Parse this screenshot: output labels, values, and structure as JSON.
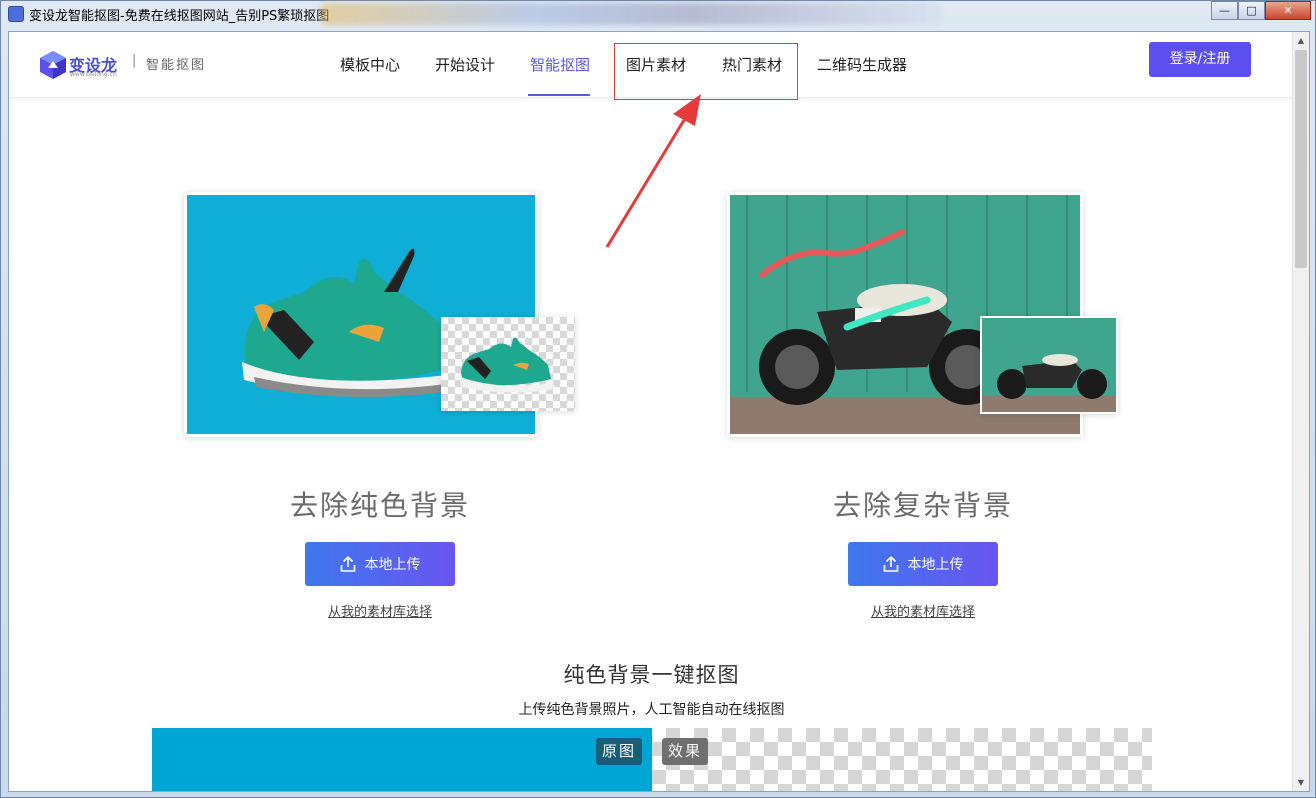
{
  "window": {
    "title": "变设龙智能抠图-免费在线抠图网站_告别PS繁琐抠图",
    "controls": {
      "minimize": "—",
      "maximize": "□",
      "close": "✕"
    }
  },
  "header": {
    "logo_text": "变设龙",
    "logo_sub": "www.bsilong.cn",
    "separator": "|",
    "tagline": "智能抠图",
    "nav": [
      {
        "label": "模板中心",
        "active": false
      },
      {
        "label": "开始设计",
        "active": false
      },
      {
        "label": "智能抠图",
        "active": true
      },
      {
        "label": "图片素材",
        "active": false
      },
      {
        "label": "热门素材",
        "active": false
      },
      {
        "label": "二维码生成器",
        "active": false
      }
    ],
    "login_label": "登录/注册"
  },
  "features": [
    {
      "title": "去除纯色背景",
      "upload_label": "本地上传",
      "library_label": "从我的素材库选择"
    },
    {
      "title": "去除复杂背景",
      "upload_label": "本地上传",
      "library_label": "从我的素材库选择"
    }
  ],
  "section": {
    "title": "纯色背景一键抠图",
    "subtitle": "上传纯色背景照片，人工智能自动在线抠图",
    "tag_original": "原图",
    "tag_effect": "效果"
  },
  "colors": {
    "accent": "#5b58e6",
    "annotation": "#e53b3b",
    "solid_bg": "#00a6d3",
    "wall_green": "#3fa58e"
  }
}
